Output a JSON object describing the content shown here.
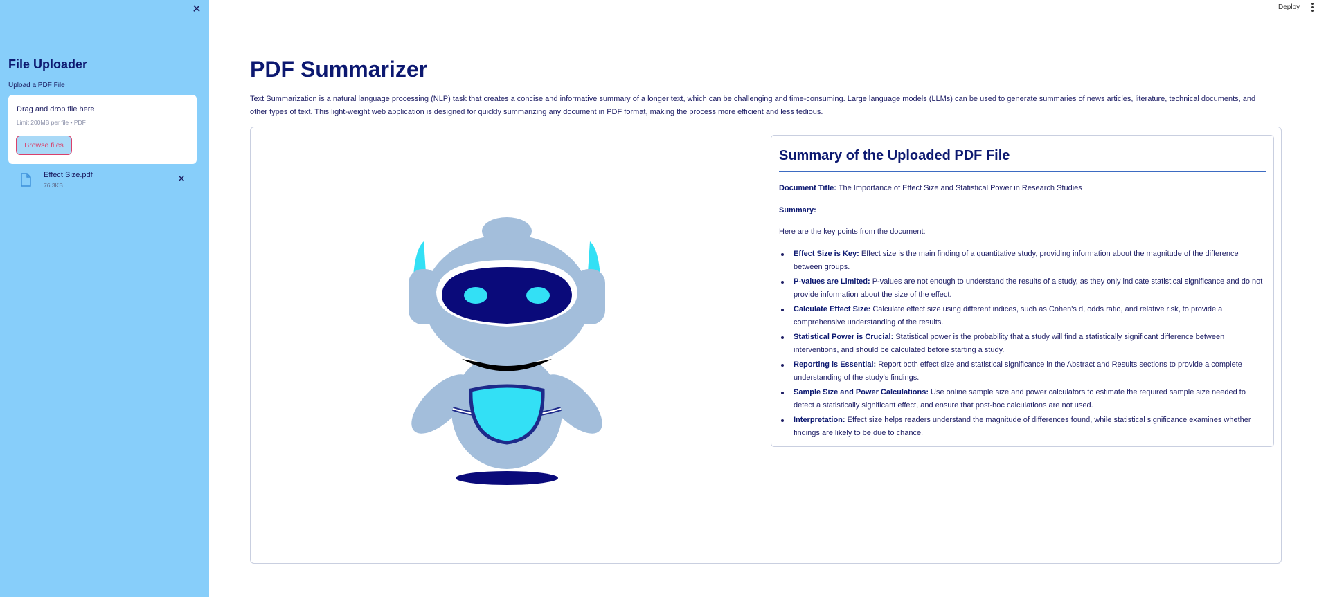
{
  "sidebar": {
    "title": "File Uploader",
    "upload_label": "Upload a PDF File",
    "dropzone": {
      "title": "Drag and drop file here",
      "limit": "Limit 200MB per file • PDF",
      "browse_label": "Browse files"
    },
    "file": {
      "name": "Effect Size.pdf",
      "size": "76.3KB"
    }
  },
  "header": {
    "deploy_label": "Deploy"
  },
  "main": {
    "title": "PDF Summarizer",
    "intro": "Text Summarization is a natural language processing (NLP) task that creates a concise and informative summary of a longer text, which can be challenging and time-consuming. Large language models (LLMs) can be used to generate summaries of news articles, literature, technical documents, and other types of text. This light-weight web application is designed for quickly summarizing any document in PDF format, making the process more efficient and less tedious."
  },
  "summary": {
    "title": "Summary of the Uploaded PDF File",
    "doc_title_label": "Document Title:",
    "doc_title_value": " The Importance of Effect Size and Statistical Power in Research Studies",
    "summary_label": "Summary:",
    "lead": "Here are the key points from the document:",
    "points": [
      {
        "label": "Effect Size is Key:",
        "text": " Effect size is the main finding of a quantitative study, providing information about the magnitude of the difference between groups."
      },
      {
        "label": "P-values are Limited:",
        "text": " P-values are not enough to understand the results of a study, as they only indicate statistical significance and do not provide information about the size of the effect."
      },
      {
        "label": "Calculate Effect Size:",
        "text": " Calculate effect size using different indices, such as Cohen's d, odds ratio, and relative risk, to provide a comprehensive understanding of the results."
      },
      {
        "label": "Statistical Power is Crucial:",
        "text": " Statistical power is the probability that a study will find a statistically significant difference between interventions, and should be calculated before starting a study."
      },
      {
        "label": "Reporting is Essential:",
        "text": " Report both effect size and statistical significance in the Abstract and Results sections to provide a complete understanding of the study's findings."
      },
      {
        "label": "Sample Size and Power Calculations:",
        "text": " Use online sample size and power calculators to estimate the required sample size needed to detect a statistically significant effect, and ensure that post-hoc calculations are not used."
      },
      {
        "label": "Interpretation:",
        "text": " Effect size helps readers understand the magnitude of differences found, while statistical significance examines whether findings are likely to be due to chance."
      }
    ]
  },
  "icons": {
    "sidebar_close": "close-icon",
    "file": "file-icon",
    "file_remove": "close-icon",
    "menu": "kebab-menu-icon"
  },
  "colors": {
    "sidebar_bg": "#87cefa",
    "title": "#0c1870",
    "accent": "#d9416b",
    "robot_body": "#a3bedb",
    "robot_face": "#0a0a7a",
    "robot_eye": "#33e0f5"
  }
}
